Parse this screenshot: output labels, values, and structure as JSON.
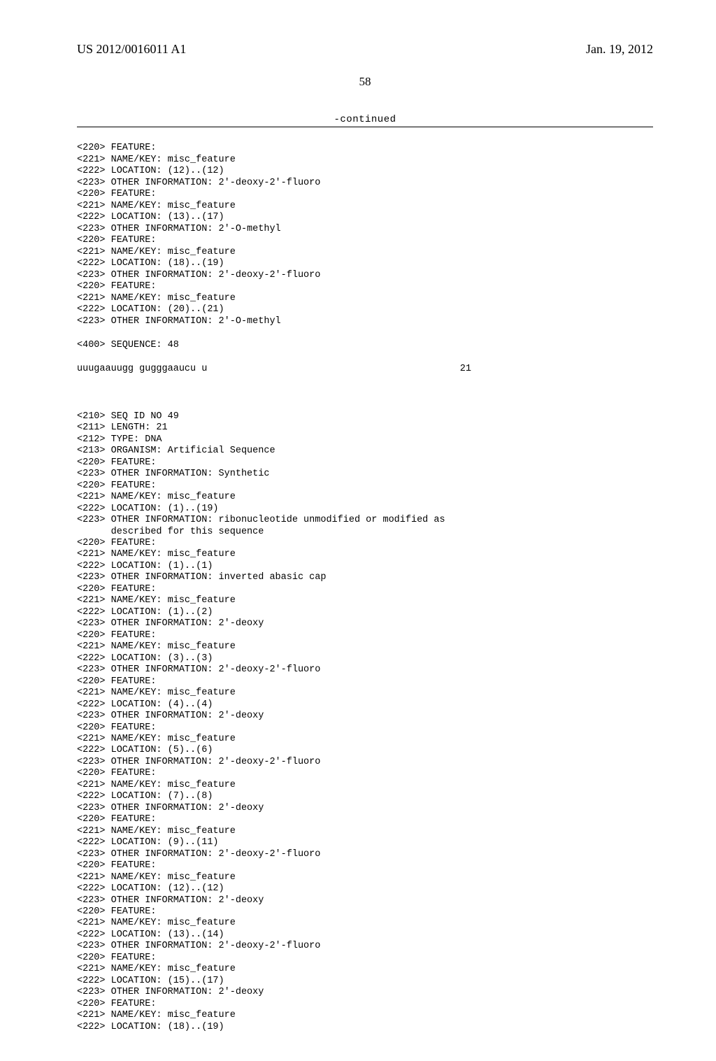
{
  "header": {
    "pub_num": "US 2012/0016011 A1",
    "pub_date": "Jan. 19, 2012"
  },
  "page_number": "58",
  "continued": "-continued",
  "seq48": {
    "features": [
      [
        "<220> FEATURE:",
        "<221> NAME/KEY: misc_feature",
        "<222> LOCATION: (12)..(12)",
        "<223> OTHER INFORMATION: 2'-deoxy-2'-fluoro"
      ],
      [
        "<220> FEATURE:",
        "<221> NAME/KEY: misc_feature",
        "<222> LOCATION: (13)..(17)",
        "<223> OTHER INFORMATION: 2'-O-methyl"
      ],
      [
        "<220> FEATURE:",
        "<221> NAME/KEY: misc_feature",
        "<222> LOCATION: (18)..(19)",
        "<223> OTHER INFORMATION: 2'-deoxy-2'-fluoro"
      ],
      [
        "<220> FEATURE:",
        "<221> NAME/KEY: misc_feature",
        "<222> LOCATION: (20)..(21)",
        "<223> OTHER INFORMATION: 2'-O-methyl"
      ]
    ],
    "seqlabel": "<400> SEQUENCE: 48",
    "sequence": "uuugaauugg gugggaaucu u",
    "length": "21"
  },
  "seq49": {
    "header": [
      "<210> SEQ ID NO 49",
      "<211> LENGTH: 21",
      "<212> TYPE: DNA",
      "<213> ORGANISM: Artificial Sequence"
    ],
    "synth": [
      "<220> FEATURE:",
      "<223> OTHER INFORMATION: Synthetic"
    ],
    "features": [
      [
        "<220> FEATURE:",
        "<221> NAME/KEY: misc_feature",
        "<222> LOCATION: (1)..(19)",
        "<223> OTHER INFORMATION: ribonucleotide unmodified or modified as",
        "      described for this sequence"
      ],
      [
        "<220> FEATURE:",
        "<221> NAME/KEY: misc_feature",
        "<222> LOCATION: (1)..(1)",
        "<223> OTHER INFORMATION: inverted abasic cap"
      ],
      [
        "<220> FEATURE:",
        "<221> NAME/KEY: misc_feature",
        "<222> LOCATION: (1)..(2)",
        "<223> OTHER INFORMATION: 2'-deoxy"
      ],
      [
        "<220> FEATURE:",
        "<221> NAME/KEY: misc_feature",
        "<222> LOCATION: (3)..(3)",
        "<223> OTHER INFORMATION: 2'-deoxy-2'-fluoro"
      ],
      [
        "<220> FEATURE:",
        "<221> NAME/KEY: misc_feature",
        "<222> LOCATION: (4)..(4)",
        "<223> OTHER INFORMATION: 2'-deoxy"
      ],
      [
        "<220> FEATURE:",
        "<221> NAME/KEY: misc_feature",
        "<222> LOCATION: (5)..(6)",
        "<223> OTHER INFORMATION: 2'-deoxy-2'-fluoro"
      ],
      [
        "<220> FEATURE:",
        "<221> NAME/KEY: misc_feature",
        "<222> LOCATION: (7)..(8)",
        "<223> OTHER INFORMATION: 2'-deoxy"
      ],
      [
        "<220> FEATURE:",
        "<221> NAME/KEY: misc_feature",
        "<222> LOCATION: (9)..(11)",
        "<223> OTHER INFORMATION: 2'-deoxy-2'-fluoro"
      ],
      [
        "<220> FEATURE:",
        "<221> NAME/KEY: misc_feature",
        "<222> LOCATION: (12)..(12)",
        "<223> OTHER INFORMATION: 2'-deoxy"
      ],
      [
        "<220> FEATURE:",
        "<221> NAME/KEY: misc_feature",
        "<222> LOCATION: (13)..(14)",
        "<223> OTHER INFORMATION: 2'-deoxy-2'-fluoro"
      ],
      [
        "<220> FEATURE:",
        "<221> NAME/KEY: misc_feature",
        "<222> LOCATION: (15)..(17)",
        "<223> OTHER INFORMATION: 2'-deoxy"
      ],
      [
        "<220> FEATURE:",
        "<221> NAME/KEY: misc_feature",
        "<222> LOCATION: (18)..(19)"
      ]
    ]
  }
}
